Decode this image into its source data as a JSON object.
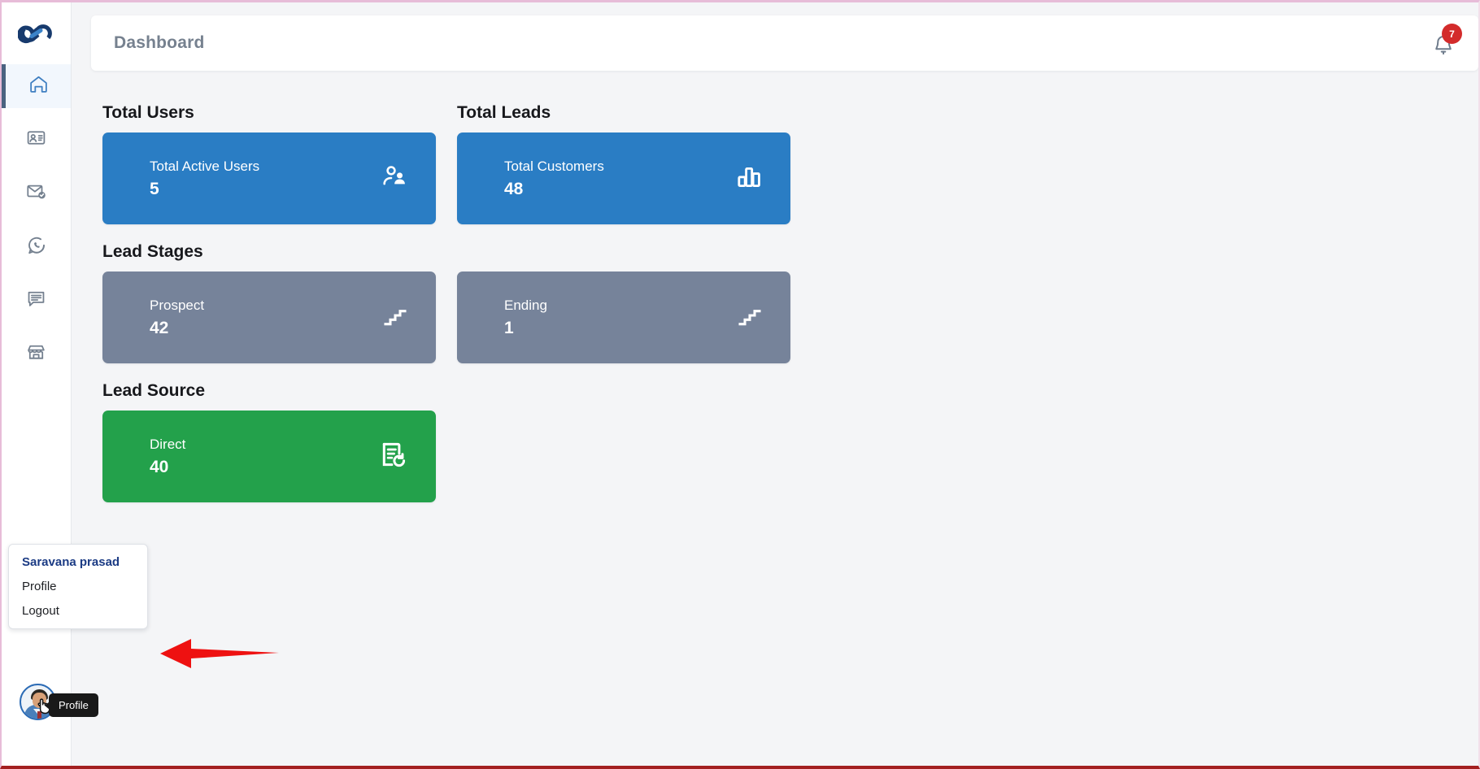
{
  "app": {
    "logo_name": "infinity-links-logo",
    "accent_blue": "#2a7dc4",
    "accent_slate": "#76839a",
    "accent_green": "#23a14b",
    "badge_red": "#d32b2b"
  },
  "sidebar": {
    "items": [
      {
        "icon": "home-icon",
        "name": "dashboard",
        "active": true
      },
      {
        "icon": "contact-card-icon",
        "name": "contacts",
        "active": false
      },
      {
        "icon": "email-verified-icon",
        "name": "email",
        "active": false
      },
      {
        "icon": "whatsapp-icon",
        "name": "whatsapp",
        "active": false
      },
      {
        "icon": "chat-message-icon",
        "name": "messages",
        "active": false
      },
      {
        "icon": "store-icon",
        "name": "store",
        "active": false
      }
    ]
  },
  "header": {
    "title": "Dashboard",
    "bell_icon": "notification-bell-icon",
    "bell_count": "7"
  },
  "main": {
    "sections": [
      {
        "title": "Total Users",
        "cards": [
          {
            "label": "Total Active Users",
            "value": "5",
            "color": "blue",
            "icon": "users-icon"
          }
        ]
      },
      {
        "title": "Total Leads",
        "cards": [
          {
            "label": "Total Customers",
            "value": "48",
            "color": "blue",
            "icon": "bar-chart-icon"
          }
        ]
      },
      {
        "title": "Lead Stages",
        "cards": [
          {
            "label": "Prospect",
            "value": "42",
            "color": "slate",
            "icon": "stairs-icon"
          },
          {
            "label": "Ending",
            "value": "1",
            "color": "slate",
            "icon": "stairs-icon"
          }
        ]
      },
      {
        "title": "Lead Source",
        "cards": [
          {
            "label": "Direct",
            "value": "40",
            "color": "green",
            "icon": "document-history-icon"
          }
        ]
      }
    ],
    "labels": {
      "total_users": "Total Users",
      "total_leads": "Total Leads",
      "lead_stages": "Lead Stages",
      "lead_source": "Lead Source",
      "total_active_users": "Total Active Users",
      "total_active_users_value": "5",
      "total_customers": "Total Customers",
      "total_customers_value": "48",
      "prospect": "Prospect",
      "prospect_value": "42",
      "ending": "Ending",
      "ending_value": "1",
      "direct": "Direct",
      "direct_value": "40"
    }
  },
  "profile_popup": {
    "user_name": "Saravana prasad",
    "items": [
      {
        "label": "Profile"
      },
      {
        "label": "Logout"
      }
    ],
    "profile_label": "Profile",
    "logout_label": "Logout"
  },
  "avatar": {
    "tooltip": "Profile",
    "name": "user-avatar"
  },
  "annotation": {
    "arrow_color": "#ee1111",
    "arrow_direction": "left"
  }
}
